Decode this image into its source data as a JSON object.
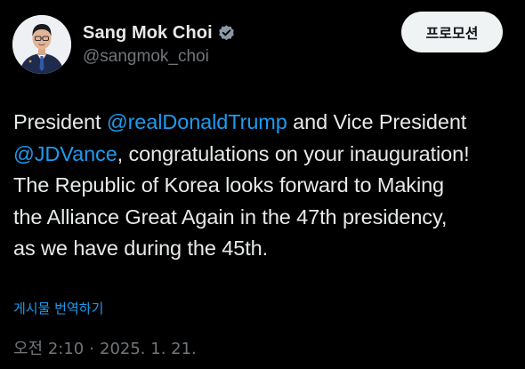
{
  "author": {
    "display_name": "Sang Mok Choi",
    "handle": "@sangmok_choi",
    "verified_icon": "verified-badge-icon",
    "avatar_icon": "profile-photo"
  },
  "header": {
    "promo_label": "프로모션"
  },
  "post": {
    "line1": {
      "pre": "President ",
      "mention": "@realDonaldTrump",
      "post": " and Vice President"
    },
    "line2": {
      "mention": "@JDVance",
      "post": ", congratulations on your inauguration!"
    },
    "line3": "The Republic of Korea looks forward to Making",
    "line4": "the Alliance Great Again in the 47th presidency,",
    "line5": "as we have during the 45th.",
    "translate_label": "게시물 번역하기"
  },
  "meta": {
    "time": "오전 2:10",
    "separator": "·",
    "date": "2025. 1. 21."
  },
  "colors": {
    "background": "#000000",
    "text": "#e7e9ea",
    "muted": "#71767b",
    "link": "#1d9bf0",
    "button_bg": "#eff3f4"
  }
}
